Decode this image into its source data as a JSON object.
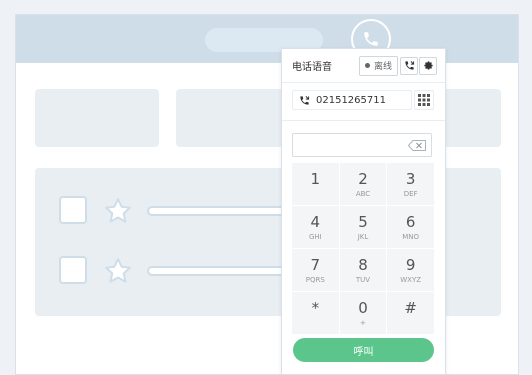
{
  "dialer": {
    "title": "电话语音",
    "status_label": "离线",
    "phone_number": "02151265711",
    "input_value": "",
    "call_label": "呼叫",
    "keys": [
      {
        "digit": "1",
        "letters": ""
      },
      {
        "digit": "2",
        "letters": "ABC"
      },
      {
        "digit": "3",
        "letters": "DEF"
      },
      {
        "digit": "4",
        "letters": "GHI"
      },
      {
        "digit": "5",
        "letters": "JKL"
      },
      {
        "digit": "6",
        "letters": "MNO"
      },
      {
        "digit": "7",
        "letters": "PQRS"
      },
      {
        "digit": "8",
        "letters": "TUV"
      },
      {
        "digit": "9",
        "letters": "WXYZ"
      },
      {
        "digit": "*",
        "letters": ""
      },
      {
        "digit": "0",
        "letters": "+"
      },
      {
        "digit": "#",
        "letters": ""
      }
    ]
  },
  "colors": {
    "call_button": "#5cc58c",
    "header_bar": "#cfdde9",
    "placeholder_block": "#e9eef2"
  },
  "icons": {
    "header_fab": "phone-icon",
    "status": "status-dot-icon",
    "transfer": "phone-transfer-icon",
    "settings": "gear-icon",
    "keypad": "keypad-grid-icon",
    "backspace": "backspace-icon",
    "favorite": "star-icon"
  }
}
